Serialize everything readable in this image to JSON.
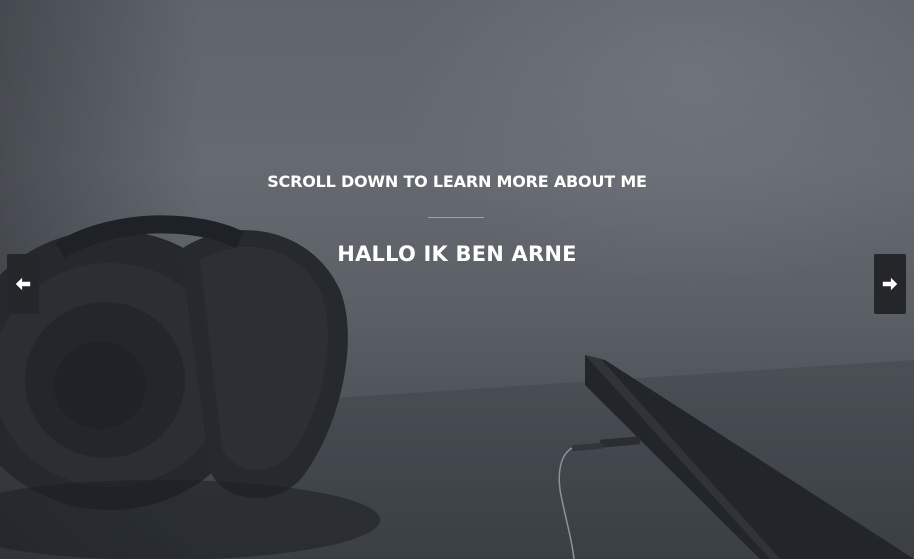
{
  "hero": {
    "subtitle": "SCROLL DOWN TO LEARN MORE ABOUT ME",
    "title": "HALLO IK BEN ARNE",
    "divider_color": "#c79a63"
  },
  "carousel": {
    "prev_icon": "arrow-left-icon",
    "next_icon": "arrow-right-icon"
  }
}
